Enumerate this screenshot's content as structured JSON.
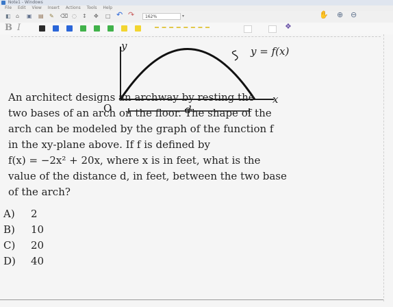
{
  "window": {
    "title": "Note1 - Windows"
  },
  "menu": [
    "File",
    "Edit",
    "View",
    "Insert",
    "Actions",
    "Tools",
    "Help"
  ],
  "toolbar": {
    "zoom": "162%",
    "bold": "B",
    "italic": "I",
    "swatch_colors": [
      "#2b2b2b",
      "#2b66d8",
      "#2b66d8",
      "#41b24b",
      "#41b24b",
      "#41b24b",
      "#f2d531",
      "#f2d531"
    ]
  },
  "diagram": {
    "y_label": "y",
    "curve_label": "y = f(x)",
    "x_label": "x",
    "origin_label": "O",
    "distance_label": "d"
  },
  "problem": {
    "lines": [
      "An architect designs an archway by resting the",
      "two bases of an arch on the floor. The shape of the",
      "arch can be modeled by the graph of the function f",
      "in the xy-plane above. If f is defined by",
      "f(x) = −2x² + 20x, where x is in feet, what is the",
      "value of the distance d, in feet, between the two base",
      "of the arch?"
    ]
  },
  "choices": [
    {
      "letter": "A)",
      "value": "2"
    },
    {
      "letter": "B)",
      "value": "10"
    },
    {
      "letter": "C)",
      "value": "20"
    },
    {
      "letter": "D)",
      "value": "40"
    }
  ]
}
